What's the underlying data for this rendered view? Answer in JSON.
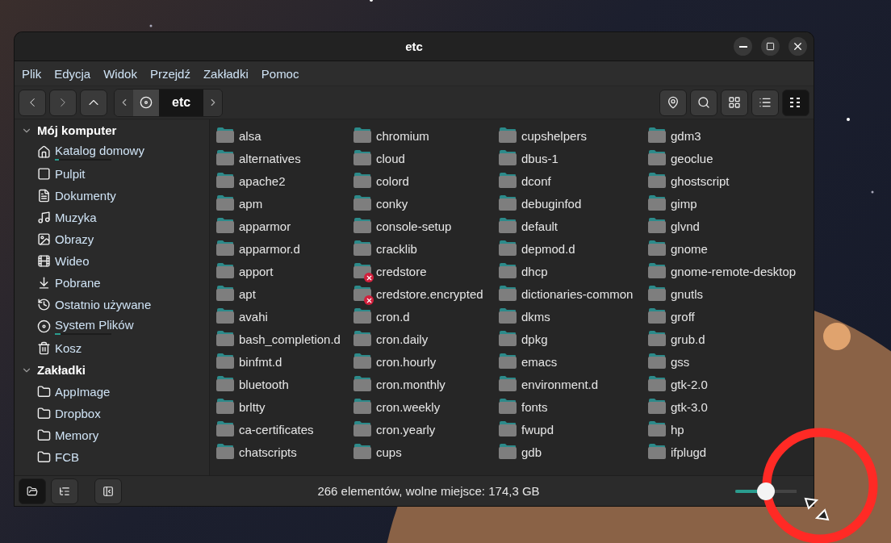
{
  "window": {
    "title": "etc"
  },
  "menu": [
    "Plik",
    "Edycja",
    "Widok",
    "Przejdź",
    "Zakładki",
    "Pomoc"
  ],
  "breadcrumb": {
    "current": "etc"
  },
  "view_buttons": [
    {
      "kind": "location",
      "selected": false
    },
    {
      "kind": "search",
      "selected": false
    },
    {
      "kind": "icons",
      "selected": false
    },
    {
      "kind": "list",
      "selected": false
    },
    {
      "kind": "compact",
      "selected": true
    }
  ],
  "sidebar": {
    "sections": [
      {
        "title": "Mój komputer",
        "expanded": true,
        "items": [
          {
            "label": "Katalog domowy",
            "kind": "home",
            "level": 0.07
          },
          {
            "label": "Pulpit",
            "kind": "desktop"
          },
          {
            "label": "Dokumenty",
            "kind": "documents"
          },
          {
            "label": "Muzyka",
            "kind": "music"
          },
          {
            "label": "Obrazy",
            "kind": "pictures"
          },
          {
            "label": "Wideo",
            "kind": "videos"
          },
          {
            "label": "Pobrane",
            "kind": "downloads"
          },
          {
            "label": "Ostatnio używane",
            "kind": "recent"
          },
          {
            "label": "System Plików",
            "kind": "filesystem",
            "level": 0.1
          },
          {
            "label": "Kosz",
            "kind": "trash"
          }
        ]
      },
      {
        "title": "Zakładki",
        "expanded": true,
        "items": [
          {
            "label": "AppImage",
            "kind": "folder"
          },
          {
            "label": "Dropbox",
            "kind": "folder"
          },
          {
            "label": "Memory",
            "kind": "folder"
          },
          {
            "label": "FCB",
            "kind": "folder"
          }
        ]
      }
    ]
  },
  "files": [
    {
      "name": "alsa",
      "unreadable": false
    },
    {
      "name": "alternatives",
      "unreadable": false
    },
    {
      "name": "apache2",
      "unreadable": false
    },
    {
      "name": "apm",
      "unreadable": false
    },
    {
      "name": "apparmor",
      "unreadable": false
    },
    {
      "name": "apparmor.d",
      "unreadable": false
    },
    {
      "name": "apport",
      "unreadable": false
    },
    {
      "name": "apt",
      "unreadable": false
    },
    {
      "name": "avahi",
      "unreadable": false
    },
    {
      "name": "bash_completion.d",
      "unreadable": false
    },
    {
      "name": "binfmt.d",
      "unreadable": false
    },
    {
      "name": "bluetooth",
      "unreadable": false
    },
    {
      "name": "brltty",
      "unreadable": false
    },
    {
      "name": "ca-certificates",
      "unreadable": false
    },
    {
      "name": "chatscripts",
      "unreadable": false
    },
    {
      "name": "chromium",
      "unreadable": false
    },
    {
      "name": "cloud",
      "unreadable": false
    },
    {
      "name": "colord",
      "unreadable": false
    },
    {
      "name": "conky",
      "unreadable": false
    },
    {
      "name": "console-setup",
      "unreadable": false
    },
    {
      "name": "cracklib",
      "unreadable": false
    },
    {
      "name": "credstore",
      "unreadable": true
    },
    {
      "name": "credstore.encrypted",
      "unreadable": true
    },
    {
      "name": "cron.d",
      "unreadable": false
    },
    {
      "name": "cron.daily",
      "unreadable": false
    },
    {
      "name": "cron.hourly",
      "unreadable": false
    },
    {
      "name": "cron.monthly",
      "unreadable": false
    },
    {
      "name": "cron.weekly",
      "unreadable": false
    },
    {
      "name": "cron.yearly",
      "unreadable": false
    },
    {
      "name": "cups",
      "unreadable": false
    },
    {
      "name": "cupshelpers",
      "unreadable": false
    },
    {
      "name": "dbus-1",
      "unreadable": false
    },
    {
      "name": "dconf",
      "unreadable": false
    },
    {
      "name": "debuginfod",
      "unreadable": false
    },
    {
      "name": "default",
      "unreadable": false
    },
    {
      "name": "depmod.d",
      "unreadable": false
    },
    {
      "name": "dhcp",
      "unreadable": false
    },
    {
      "name": "dictionaries-common",
      "unreadable": false
    },
    {
      "name": "dkms",
      "unreadable": false
    },
    {
      "name": "dpkg",
      "unreadable": false
    },
    {
      "name": "emacs",
      "unreadable": false
    },
    {
      "name": "environment.d",
      "unreadable": false
    },
    {
      "name": "fonts",
      "unreadable": false
    },
    {
      "name": "fwupd",
      "unreadable": false
    },
    {
      "name": "gdb",
      "unreadable": false
    },
    {
      "name": "gdm3",
      "unreadable": false
    },
    {
      "name": "geoclue",
      "unreadable": false
    },
    {
      "name": "ghostscript",
      "unreadable": false
    },
    {
      "name": "gimp",
      "unreadable": false
    },
    {
      "name": "glvnd",
      "unreadable": false
    },
    {
      "name": "gnome",
      "unreadable": false
    },
    {
      "name": "gnome-remote-desktop",
      "unreadable": false
    },
    {
      "name": "gnutls",
      "unreadable": false
    },
    {
      "name": "groff",
      "unreadable": false
    },
    {
      "name": "grub.d",
      "unreadable": false
    },
    {
      "name": "gss",
      "unreadable": false
    },
    {
      "name": "gtk-2.0",
      "unreadable": false
    },
    {
      "name": "gtk-3.0",
      "unreadable": false
    },
    {
      "name": "hp",
      "unreadable": false
    },
    {
      "name": "ifplugd",
      "unreadable": false
    }
  ],
  "bottom_buttons": [
    {
      "kind": "places",
      "selected": true
    },
    {
      "kind": "tree",
      "selected": false
    },
    {
      "kind": "hide",
      "selected": false
    }
  ],
  "status_bar": {
    "text": "266 elementów, wolne miejsce: 174,3 GB",
    "zoom": {
      "level": 0.5
    }
  }
}
